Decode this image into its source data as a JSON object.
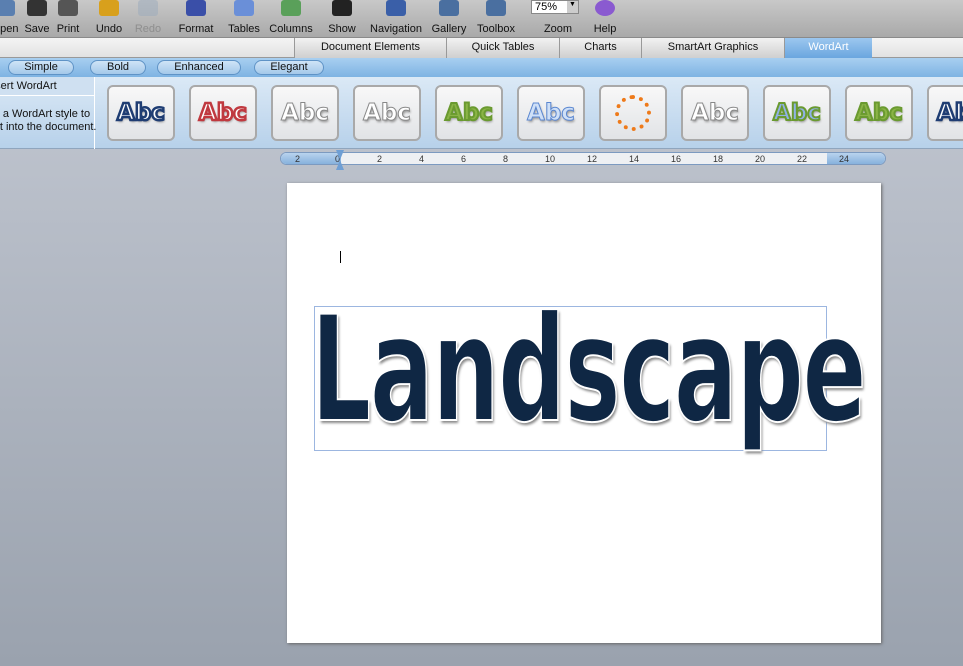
{
  "toolbar": {
    "items": [
      {
        "label": "Open",
        "icon": "open-icon"
      },
      {
        "label": "Save",
        "icon": "save-icon"
      },
      {
        "label": "Print",
        "icon": "print-icon"
      },
      {
        "label": "Undo",
        "icon": "undo-icon"
      },
      {
        "label": "Redo",
        "icon": "redo-icon",
        "disabled": true
      },
      {
        "label": "Format",
        "icon": "format-brush-icon"
      },
      {
        "label": "Tables",
        "icon": "table-icon"
      },
      {
        "label": "Columns",
        "icon": "columns-icon"
      },
      {
        "label": "Show",
        "icon": "pilcrow-icon"
      },
      {
        "label": "Navigation",
        "icon": "navigation-icon"
      },
      {
        "label": "Gallery",
        "icon": "gallery-icon"
      },
      {
        "label": "Toolbox",
        "icon": "toolbox-icon"
      },
      {
        "label": "Zoom"
      },
      {
        "label": "Help",
        "icon": "help-icon"
      }
    ],
    "zoom_value": "75%"
  },
  "ribbon_tabs": [
    "Document Elements",
    "Quick Tables",
    "Charts",
    "SmartArt Graphics",
    "WordArt"
  ],
  "active_tab": "WordArt",
  "style_groups": [
    "Simple",
    "Bold",
    "Enhanced",
    "Elegant"
  ],
  "gallery": {
    "title": "Insert WordArt",
    "description_line1": "Click a WordArt style to",
    "description_line2": "insert into the document.",
    "thumb_text": "Abc",
    "circle_text": "Abcdefghijklmnop",
    "colors": [
      "#1f3d73",
      "#c0393f",
      "#ffffff",
      "#ffffff",
      "#8ab446",
      "#6f96d8",
      "#ee7a1a",
      "#ffffff",
      "#8fb1e6",
      "#8ab446",
      "#1f3d73"
    ]
  },
  "ruler": {
    "labels": [
      "2",
      "0",
      "2",
      "4",
      "6",
      "8",
      "10",
      "12",
      "14",
      "16",
      "18",
      "20",
      "22",
      "24"
    ]
  },
  "document": {
    "wordart_text": "Landscape"
  }
}
